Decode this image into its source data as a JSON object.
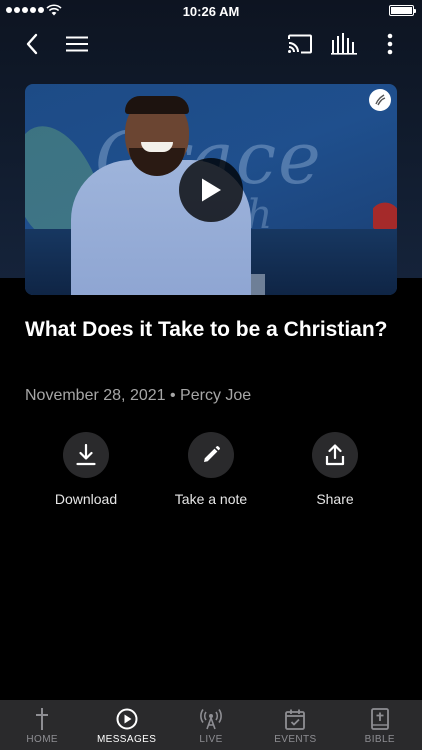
{
  "status_bar": {
    "time": "10:26 AM"
  },
  "nav": {
    "back_icon": "chevron-left-icon",
    "menu_icon": "hamburger-menu-icon",
    "cast_icon": "cast-icon",
    "audio_icon": "audio-bars-icon",
    "more_icon": "more-vertical-icon"
  },
  "video": {
    "backdrop_text": "Grace",
    "backdrop_subtext": "Ch     ch",
    "play_icon": "play-icon"
  },
  "sermon": {
    "title": "What Does it Take to be a Christian?",
    "date": "November 28, 2021",
    "separator": "•",
    "speaker": "Percy Joe"
  },
  "actions": [
    {
      "label": "Download",
      "icon": "download-icon"
    },
    {
      "label": "Take a note",
      "icon": "pencil-icon"
    },
    {
      "label": "Share",
      "icon": "share-icon"
    }
  ],
  "tabs": [
    {
      "label": "HOME",
      "icon": "cross-icon",
      "active": false
    },
    {
      "label": "MESSAGES",
      "icon": "play-circle-icon",
      "active": true
    },
    {
      "label": "LIVE",
      "icon": "broadcast-icon",
      "active": false
    },
    {
      "label": "EVENTS",
      "icon": "calendar-icon",
      "active": false
    },
    {
      "label": "BIBLE",
      "icon": "bible-icon",
      "active": false
    }
  ],
  "colors": {
    "background": "#000000",
    "tabbar": "#2a2a2c",
    "action_circle": "#2a2a2c",
    "meta_text": "#a6a6a6"
  }
}
